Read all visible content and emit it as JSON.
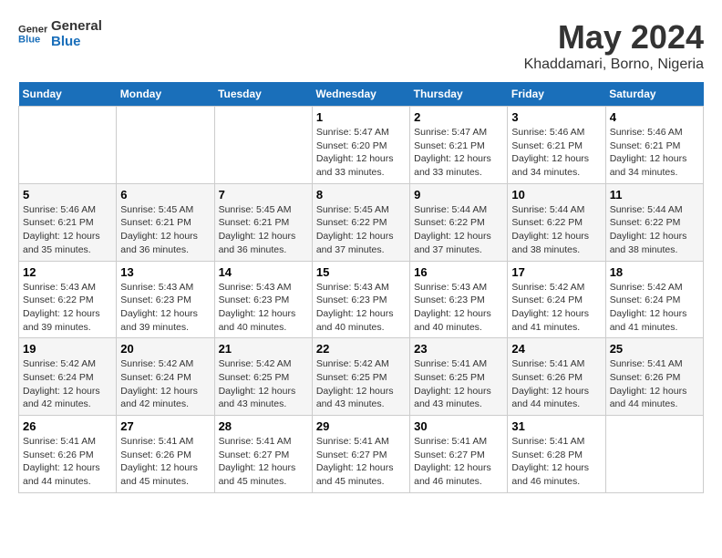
{
  "logo": {
    "line1": "General",
    "line2": "Blue"
  },
  "title": "May 2024",
  "subtitle": "Khaddamari, Borno, Nigeria",
  "days_header": [
    "Sunday",
    "Monday",
    "Tuesday",
    "Wednesday",
    "Thursday",
    "Friday",
    "Saturday"
  ],
  "weeks": [
    [
      {
        "day": "",
        "info": ""
      },
      {
        "day": "",
        "info": ""
      },
      {
        "day": "",
        "info": ""
      },
      {
        "day": "1",
        "info": "Sunrise: 5:47 AM\nSunset: 6:20 PM\nDaylight: 12 hours\nand 33 minutes."
      },
      {
        "day": "2",
        "info": "Sunrise: 5:47 AM\nSunset: 6:21 PM\nDaylight: 12 hours\nand 33 minutes."
      },
      {
        "day": "3",
        "info": "Sunrise: 5:46 AM\nSunset: 6:21 PM\nDaylight: 12 hours\nand 34 minutes."
      },
      {
        "day": "4",
        "info": "Sunrise: 5:46 AM\nSunset: 6:21 PM\nDaylight: 12 hours\nand 34 minutes."
      }
    ],
    [
      {
        "day": "5",
        "info": "Sunrise: 5:46 AM\nSunset: 6:21 PM\nDaylight: 12 hours\nand 35 minutes."
      },
      {
        "day": "6",
        "info": "Sunrise: 5:45 AM\nSunset: 6:21 PM\nDaylight: 12 hours\nand 36 minutes."
      },
      {
        "day": "7",
        "info": "Sunrise: 5:45 AM\nSunset: 6:21 PM\nDaylight: 12 hours\nand 36 minutes."
      },
      {
        "day": "8",
        "info": "Sunrise: 5:45 AM\nSunset: 6:22 PM\nDaylight: 12 hours\nand 37 minutes."
      },
      {
        "day": "9",
        "info": "Sunrise: 5:44 AM\nSunset: 6:22 PM\nDaylight: 12 hours\nand 37 minutes."
      },
      {
        "day": "10",
        "info": "Sunrise: 5:44 AM\nSunset: 6:22 PM\nDaylight: 12 hours\nand 38 minutes."
      },
      {
        "day": "11",
        "info": "Sunrise: 5:44 AM\nSunset: 6:22 PM\nDaylight: 12 hours\nand 38 minutes."
      }
    ],
    [
      {
        "day": "12",
        "info": "Sunrise: 5:43 AM\nSunset: 6:22 PM\nDaylight: 12 hours\nand 39 minutes."
      },
      {
        "day": "13",
        "info": "Sunrise: 5:43 AM\nSunset: 6:23 PM\nDaylight: 12 hours\nand 39 minutes."
      },
      {
        "day": "14",
        "info": "Sunrise: 5:43 AM\nSunset: 6:23 PM\nDaylight: 12 hours\nand 40 minutes."
      },
      {
        "day": "15",
        "info": "Sunrise: 5:43 AM\nSunset: 6:23 PM\nDaylight: 12 hours\nand 40 minutes."
      },
      {
        "day": "16",
        "info": "Sunrise: 5:43 AM\nSunset: 6:23 PM\nDaylight: 12 hours\nand 40 minutes."
      },
      {
        "day": "17",
        "info": "Sunrise: 5:42 AM\nSunset: 6:24 PM\nDaylight: 12 hours\nand 41 minutes."
      },
      {
        "day": "18",
        "info": "Sunrise: 5:42 AM\nSunset: 6:24 PM\nDaylight: 12 hours\nand 41 minutes."
      }
    ],
    [
      {
        "day": "19",
        "info": "Sunrise: 5:42 AM\nSunset: 6:24 PM\nDaylight: 12 hours\nand 42 minutes."
      },
      {
        "day": "20",
        "info": "Sunrise: 5:42 AM\nSunset: 6:24 PM\nDaylight: 12 hours\nand 42 minutes."
      },
      {
        "day": "21",
        "info": "Sunrise: 5:42 AM\nSunset: 6:25 PM\nDaylight: 12 hours\nand 43 minutes."
      },
      {
        "day": "22",
        "info": "Sunrise: 5:42 AM\nSunset: 6:25 PM\nDaylight: 12 hours\nand 43 minutes."
      },
      {
        "day": "23",
        "info": "Sunrise: 5:41 AM\nSunset: 6:25 PM\nDaylight: 12 hours\nand 43 minutes."
      },
      {
        "day": "24",
        "info": "Sunrise: 5:41 AM\nSunset: 6:26 PM\nDaylight: 12 hours\nand 44 minutes."
      },
      {
        "day": "25",
        "info": "Sunrise: 5:41 AM\nSunset: 6:26 PM\nDaylight: 12 hours\nand 44 minutes."
      }
    ],
    [
      {
        "day": "26",
        "info": "Sunrise: 5:41 AM\nSunset: 6:26 PM\nDaylight: 12 hours\nand 44 minutes."
      },
      {
        "day": "27",
        "info": "Sunrise: 5:41 AM\nSunset: 6:26 PM\nDaylight: 12 hours\nand 45 minutes."
      },
      {
        "day": "28",
        "info": "Sunrise: 5:41 AM\nSunset: 6:27 PM\nDaylight: 12 hours\nand 45 minutes."
      },
      {
        "day": "29",
        "info": "Sunrise: 5:41 AM\nSunset: 6:27 PM\nDaylight: 12 hours\nand 45 minutes."
      },
      {
        "day": "30",
        "info": "Sunrise: 5:41 AM\nSunset: 6:27 PM\nDaylight: 12 hours\nand 46 minutes."
      },
      {
        "day": "31",
        "info": "Sunrise: 5:41 AM\nSunset: 6:28 PM\nDaylight: 12 hours\nand 46 minutes."
      },
      {
        "day": "",
        "info": ""
      }
    ]
  ]
}
